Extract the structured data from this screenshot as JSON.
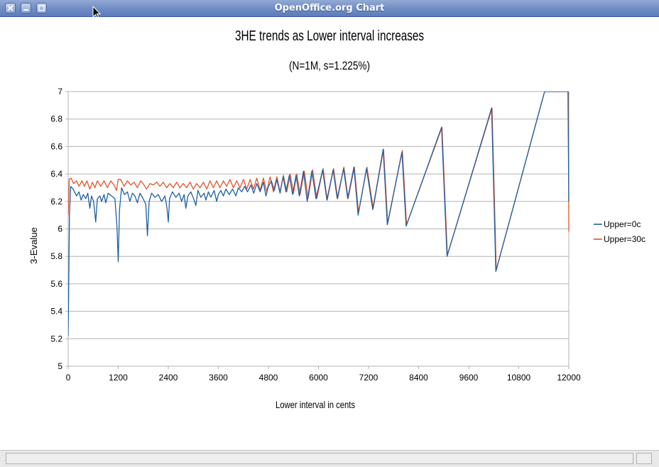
{
  "window": {
    "title": "OpenOffice.org Chart",
    "buttons": [
      "close",
      "minimize",
      "maximize"
    ]
  },
  "chart_data": {
    "type": "line",
    "title": "3HE trends as Lower interval increases",
    "subtitle": "(N=1M, s=1.225%)",
    "xlabel": "Lower interval in cents",
    "ylabel": "3-Evalue",
    "xlim": [
      0,
      12000
    ],
    "ylim": [
      5,
      7
    ],
    "xticks": [
      "0",
      "1200",
      "2400",
      "3600",
      "4800",
      "6000",
      "7200",
      "8400",
      "9600",
      "10800",
      "12000"
    ],
    "yticks": [
      "5",
      "5.2",
      "5.4",
      "5.6",
      "5.8",
      "6",
      "6.2",
      "6.4",
      "6.6",
      "6.8",
      "7"
    ],
    "grid": "horizontal",
    "legend_position": "right",
    "series": [
      {
        "name": "Upper=0c",
        "color": "#1f5fa3",
        "points": [
          [
            0,
            5.22
          ],
          [
            30,
            6.1
          ],
          [
            60,
            6.31
          ],
          [
            120,
            6.29
          ],
          [
            200,
            6.24
          ],
          [
            260,
            6.27
          ],
          [
            310,
            6.21
          ],
          [
            360,
            6.25
          ],
          [
            420,
            6.22
          ],
          [
            470,
            6.26
          ],
          [
            520,
            6.15
          ],
          [
            560,
            6.24
          ],
          [
            610,
            6.2
          ],
          [
            660,
            6.05
          ],
          [
            700,
            6.22
          ],
          [
            760,
            6.24
          ],
          [
            800,
            6.2
          ],
          [
            860,
            6.25
          ],
          [
            900,
            6.19
          ],
          [
            960,
            6.26
          ],
          [
            1040,
            6.24
          ],
          [
            1120,
            6.22
          ],
          [
            1170,
            6.02
          ],
          [
            1200,
            5.76
          ],
          [
            1230,
            6.14
          ],
          [
            1280,
            6.3
          ],
          [
            1350,
            6.25
          ],
          [
            1420,
            6.27
          ],
          [
            1480,
            6.2
          ],
          [
            1540,
            6.26
          ],
          [
            1600,
            6.24
          ],
          [
            1660,
            6.19
          ],
          [
            1720,
            6.26
          ],
          [
            1780,
            6.23
          ],
          [
            1860,
            6.18
          ],
          [
            1900,
            5.95
          ],
          [
            1940,
            6.2
          ],
          [
            2000,
            6.26
          ],
          [
            2080,
            6.23
          ],
          [
            2160,
            6.25
          ],
          [
            2240,
            6.2
          ],
          [
            2320,
            6.24
          ],
          [
            2370,
            6.15
          ],
          [
            2400,
            6.05
          ],
          [
            2430,
            6.22
          ],
          [
            2500,
            6.27
          ],
          [
            2580,
            6.23
          ],
          [
            2660,
            6.26
          ],
          [
            2720,
            6.2
          ],
          [
            2780,
            6.25
          ],
          [
            2820,
            6.15
          ],
          [
            2870,
            6.24
          ],
          [
            2940,
            6.27
          ],
          [
            3020,
            6.21
          ],
          [
            3060,
            6.17
          ],
          [
            3110,
            6.28
          ],
          [
            3180,
            6.23
          ],
          [
            3260,
            6.26
          ],
          [
            3300,
            6.21
          ],
          [
            3360,
            6.27
          ],
          [
            3420,
            6.23
          ],
          [
            3500,
            6.28
          ],
          [
            3560,
            6.2
          ],
          [
            3600,
            6.25
          ],
          [
            3660,
            6.28
          ],
          [
            3720,
            6.24
          ],
          [
            3780,
            6.29
          ],
          [
            3860,
            6.25
          ],
          [
            3940,
            6.29
          ],
          [
            4020,
            6.24
          ],
          [
            4080,
            6.3
          ],
          [
            4160,
            6.27
          ],
          [
            4230,
            6.31
          ],
          [
            4300,
            6.27
          ],
          [
            4380,
            6.32
          ],
          [
            4450,
            6.26
          ],
          [
            4520,
            6.33
          ],
          [
            4600,
            6.27
          ],
          [
            4680,
            6.34
          ],
          [
            4740,
            6.24
          ],
          [
            4800,
            6.31
          ],
          [
            4870,
            6.35
          ],
          [
            4940,
            6.28
          ],
          [
            5000,
            6.36
          ],
          [
            5080,
            6.26
          ],
          [
            5150,
            6.38
          ],
          [
            5220,
            6.27
          ],
          [
            5300,
            6.39
          ],
          [
            5380,
            6.25
          ],
          [
            5460,
            6.39
          ],
          [
            5540,
            6.24
          ],
          [
            5640,
            6.42
          ],
          [
            5730,
            6.2
          ],
          [
            5840,
            6.42
          ],
          [
            5940,
            6.22
          ],
          [
            6100,
            6.43
          ],
          [
            6200,
            6.21
          ],
          [
            6350,
            6.43
          ],
          [
            6450,
            6.22
          ],
          [
            6600,
            6.44
          ],
          [
            6700,
            6.22
          ],
          [
            6850,
            6.45
          ],
          [
            6950,
            6.1
          ],
          [
            7150,
            6.44
          ],
          [
            7300,
            6.14
          ],
          [
            7550,
            6.58
          ],
          [
            7650,
            6.03
          ],
          [
            8000,
            6.56
          ],
          [
            8100,
            6.02
          ],
          [
            8950,
            6.74
          ],
          [
            9080,
            5.8
          ],
          [
            10150,
            6.88
          ],
          [
            10250,
            5.69
          ],
          [
            11420,
            7.0
          ],
          [
            11980,
            7.0
          ],
          [
            12000,
            6.2
          ]
        ]
      },
      {
        "name": "Upper=30c",
        "color": "#e2542a",
        "points": [
          [
            0,
            6.1
          ],
          [
            25,
            6.36
          ],
          [
            70,
            6.37
          ],
          [
            130,
            6.33
          ],
          [
            200,
            6.35
          ],
          [
            260,
            6.31
          ],
          [
            330,
            6.35
          ],
          [
            390,
            6.31
          ],
          [
            450,
            6.35
          ],
          [
            520,
            6.29
          ],
          [
            580,
            6.34
          ],
          [
            640,
            6.3
          ],
          [
            700,
            6.35
          ],
          [
            780,
            6.31
          ],
          [
            860,
            6.35
          ],
          [
            940,
            6.3
          ],
          [
            1020,
            6.35
          ],
          [
            1100,
            6.32
          ],
          [
            1160,
            6.28
          ],
          [
            1200,
            6.36
          ],
          [
            1260,
            6.36
          ],
          [
            1340,
            6.31
          ],
          [
            1420,
            6.35
          ],
          [
            1500,
            6.32
          ],
          [
            1580,
            6.34
          ],
          [
            1660,
            6.3
          ],
          [
            1740,
            6.35
          ],
          [
            1820,
            6.32
          ],
          [
            1880,
            6.29
          ],
          [
            1960,
            6.33
          ],
          [
            2040,
            6.32
          ],
          [
            2120,
            6.34
          ],
          [
            2200,
            6.31
          ],
          [
            2280,
            6.34
          ],
          [
            2360,
            6.3
          ],
          [
            2440,
            6.33
          ],
          [
            2520,
            6.3
          ],
          [
            2600,
            6.34
          ],
          [
            2680,
            6.3
          ],
          [
            2760,
            6.33
          ],
          [
            2840,
            6.3
          ],
          [
            2920,
            6.34
          ],
          [
            3000,
            6.29
          ],
          [
            3080,
            6.33
          ],
          [
            3160,
            6.3
          ],
          [
            3240,
            6.34
          ],
          [
            3320,
            6.29
          ],
          [
            3400,
            6.35
          ],
          [
            3480,
            6.3
          ],
          [
            3560,
            6.35
          ],
          [
            3640,
            6.3
          ],
          [
            3720,
            6.35
          ],
          [
            3800,
            6.31
          ],
          [
            3880,
            6.36
          ],
          [
            3960,
            6.3
          ],
          [
            4040,
            6.35
          ],
          [
            4120,
            6.3
          ],
          [
            4200,
            6.36
          ],
          [
            4280,
            6.29
          ],
          [
            4360,
            6.36
          ],
          [
            4440,
            6.29
          ],
          [
            4520,
            6.37
          ],
          [
            4600,
            6.28
          ],
          [
            4680,
            6.37
          ],
          [
            4760,
            6.27
          ],
          [
            4840,
            6.38
          ],
          [
            4920,
            6.27
          ],
          [
            5000,
            6.38
          ],
          [
            5080,
            6.27
          ],
          [
            5160,
            6.39
          ],
          [
            5240,
            6.27
          ],
          [
            5320,
            6.4
          ],
          [
            5400,
            6.26
          ],
          [
            5480,
            6.4
          ],
          [
            5560,
            6.25
          ],
          [
            5660,
            6.42
          ],
          [
            5750,
            6.22
          ],
          [
            5860,
            6.43
          ],
          [
            5960,
            6.22
          ],
          [
            6110,
            6.44
          ],
          [
            6210,
            6.21
          ],
          [
            6360,
            6.44
          ],
          [
            6460,
            6.22
          ],
          [
            6610,
            6.45
          ],
          [
            6710,
            6.22
          ],
          [
            6860,
            6.45
          ],
          [
            6960,
            6.12
          ],
          [
            7160,
            6.45
          ],
          [
            7310,
            6.15
          ],
          [
            7560,
            6.58
          ],
          [
            7660,
            6.04
          ],
          [
            8010,
            6.57
          ],
          [
            8110,
            6.03
          ],
          [
            8960,
            6.74
          ],
          [
            9090,
            5.81
          ],
          [
            10160,
            6.88
          ],
          [
            10260,
            5.7
          ],
          [
            11420,
            7.0
          ],
          [
            11990,
            7.0
          ],
          [
            12000,
            5.98
          ]
        ]
      }
    ]
  }
}
